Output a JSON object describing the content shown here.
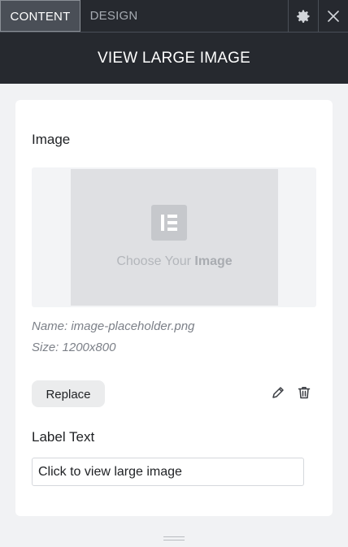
{
  "tabs": [
    {
      "label": "CONTENT",
      "active": true
    },
    {
      "label": "DESIGN",
      "active": false
    }
  ],
  "toolbar": {
    "settings_icon": "gear-icon",
    "close_icon": "close-icon"
  },
  "header": {
    "title": "VIEW LARGE IMAGE"
  },
  "image_section": {
    "label": "Image",
    "placeholder": {
      "text_prefix": "Choose Your",
      "text_strong": "Image",
      "logo_icon": "elementor-logo-icon"
    },
    "file_name": "Name: image-placeholder.png",
    "file_size": "Size: 1200x800",
    "replace_label": "Replace",
    "edit_icon": "pencil-icon",
    "delete_icon": "trash-icon"
  },
  "label_text": {
    "label": "Label Text",
    "value": "Click to view large image"
  },
  "colors": {
    "panel_dark": "#26292f",
    "active_tab": "#4a4f57",
    "card": "#ffffff",
    "background": "#f1f2f4"
  }
}
